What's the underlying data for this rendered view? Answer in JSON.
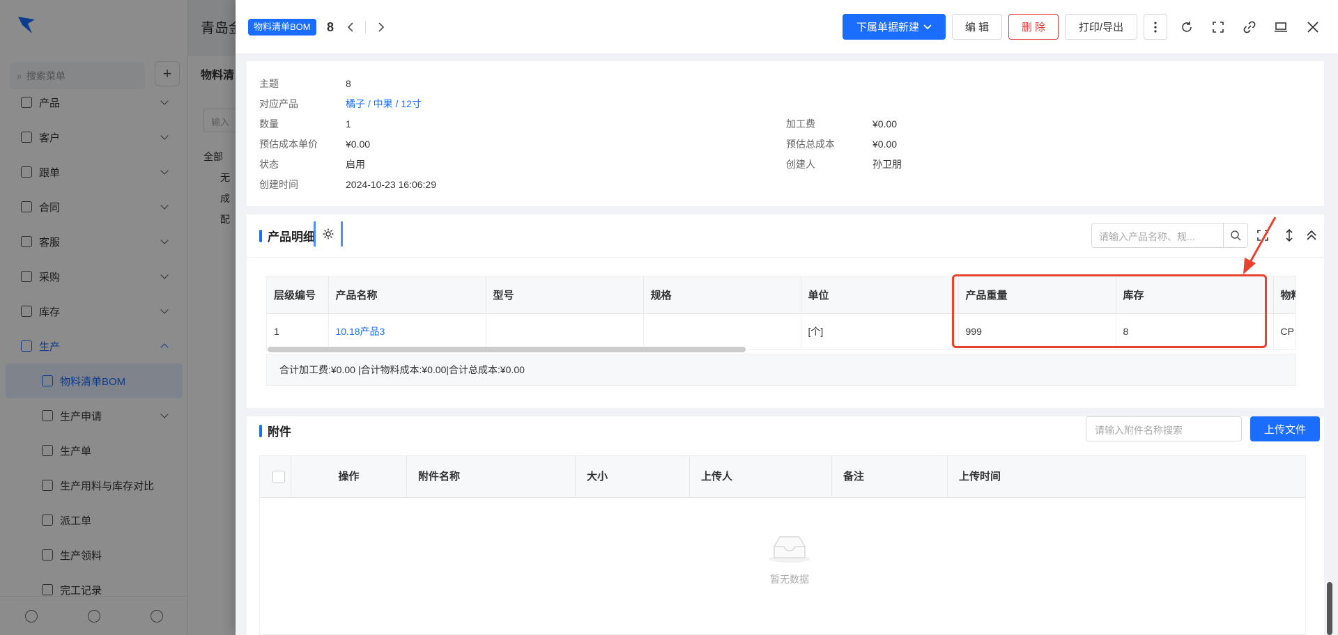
{
  "background": {
    "company": "青岛金",
    "search_placeholder": "搜索菜单",
    "panel_title": "物料清",
    "panel_input_placeholder": "输入",
    "tree": [
      "全部",
      "无",
      "成",
      "配"
    ],
    "menu": [
      {
        "label": "产品",
        "icon": "product-icon",
        "chev": "down"
      },
      {
        "label": "客户",
        "icon": "customer-icon",
        "chev": "down"
      },
      {
        "label": "跟单",
        "icon": "follow-icon",
        "chev": "down"
      },
      {
        "label": "合同",
        "icon": "contract-icon",
        "chev": "down"
      },
      {
        "label": "客服",
        "icon": "service-icon",
        "chev": "down"
      },
      {
        "label": "采购",
        "icon": "purchase-icon",
        "chev": "down"
      },
      {
        "label": "库存",
        "icon": "inventory-icon",
        "chev": "down"
      },
      {
        "label": "生产",
        "icon": "production-icon",
        "chev": "up"
      }
    ],
    "submenu": [
      {
        "label": "物料清单BOM",
        "selected": true
      },
      {
        "label": "生产申请",
        "chev": "down"
      },
      {
        "label": "生产单"
      },
      {
        "label": "生产用料与库存对比"
      },
      {
        "label": "派工单"
      },
      {
        "label": "生产领料"
      },
      {
        "label": "完工记录"
      }
    ]
  },
  "header": {
    "tag": "物料清单BOM",
    "record_no": "8",
    "btn_sub_create": "下属单据新建",
    "btn_edit": "编 辑",
    "btn_delete": "删 除",
    "btn_print": "打印/导出"
  },
  "info": {
    "subject_k": "主题",
    "subject_v": "8",
    "product_k": "对应产品",
    "product_v": "橘子 / 中果 / 12寸",
    "qty_k": "数量",
    "qty_v": "1",
    "fee_k": "加工费",
    "fee_v": "¥0.00",
    "unit_cost_k": "预估成本单价",
    "unit_cost_v": "¥0.00",
    "total_cost_k": "预估总成本",
    "total_cost_v": "¥0.00",
    "status_k": "状态",
    "status_v": "启用",
    "creator_k": "创建人",
    "creator_v": "孙卫朋",
    "created_k": "创建时间",
    "created_v": "2024-10-23 16:06:29"
  },
  "detail": {
    "title": "产品明细",
    "search_placeholder": "请输入产品名称、规...",
    "columns": [
      "层级编号",
      "产品名称",
      "型号",
      "规格",
      "单位",
      "产品重量",
      "库存",
      "物料"
    ],
    "row": [
      "1",
      "10.18产品3",
      "",
      "",
      "[个]",
      "999",
      "8",
      "CP"
    ],
    "summary": "合计加工费:¥0.00 |合计物料成本:¥0.00|合计总成本:¥0.00"
  },
  "attach": {
    "title": "附件",
    "search_placeholder": "请输入附件名称搜索",
    "upload": "上传文件",
    "columns": [
      "操作",
      "附件名称",
      "大小",
      "上传人",
      "备注",
      "上传时间"
    ],
    "empty": "暂无数据"
  },
  "colors": {
    "primary": "#1a6dff",
    "danger": "#e23c3c",
    "highlight": "#e8412d"
  }
}
